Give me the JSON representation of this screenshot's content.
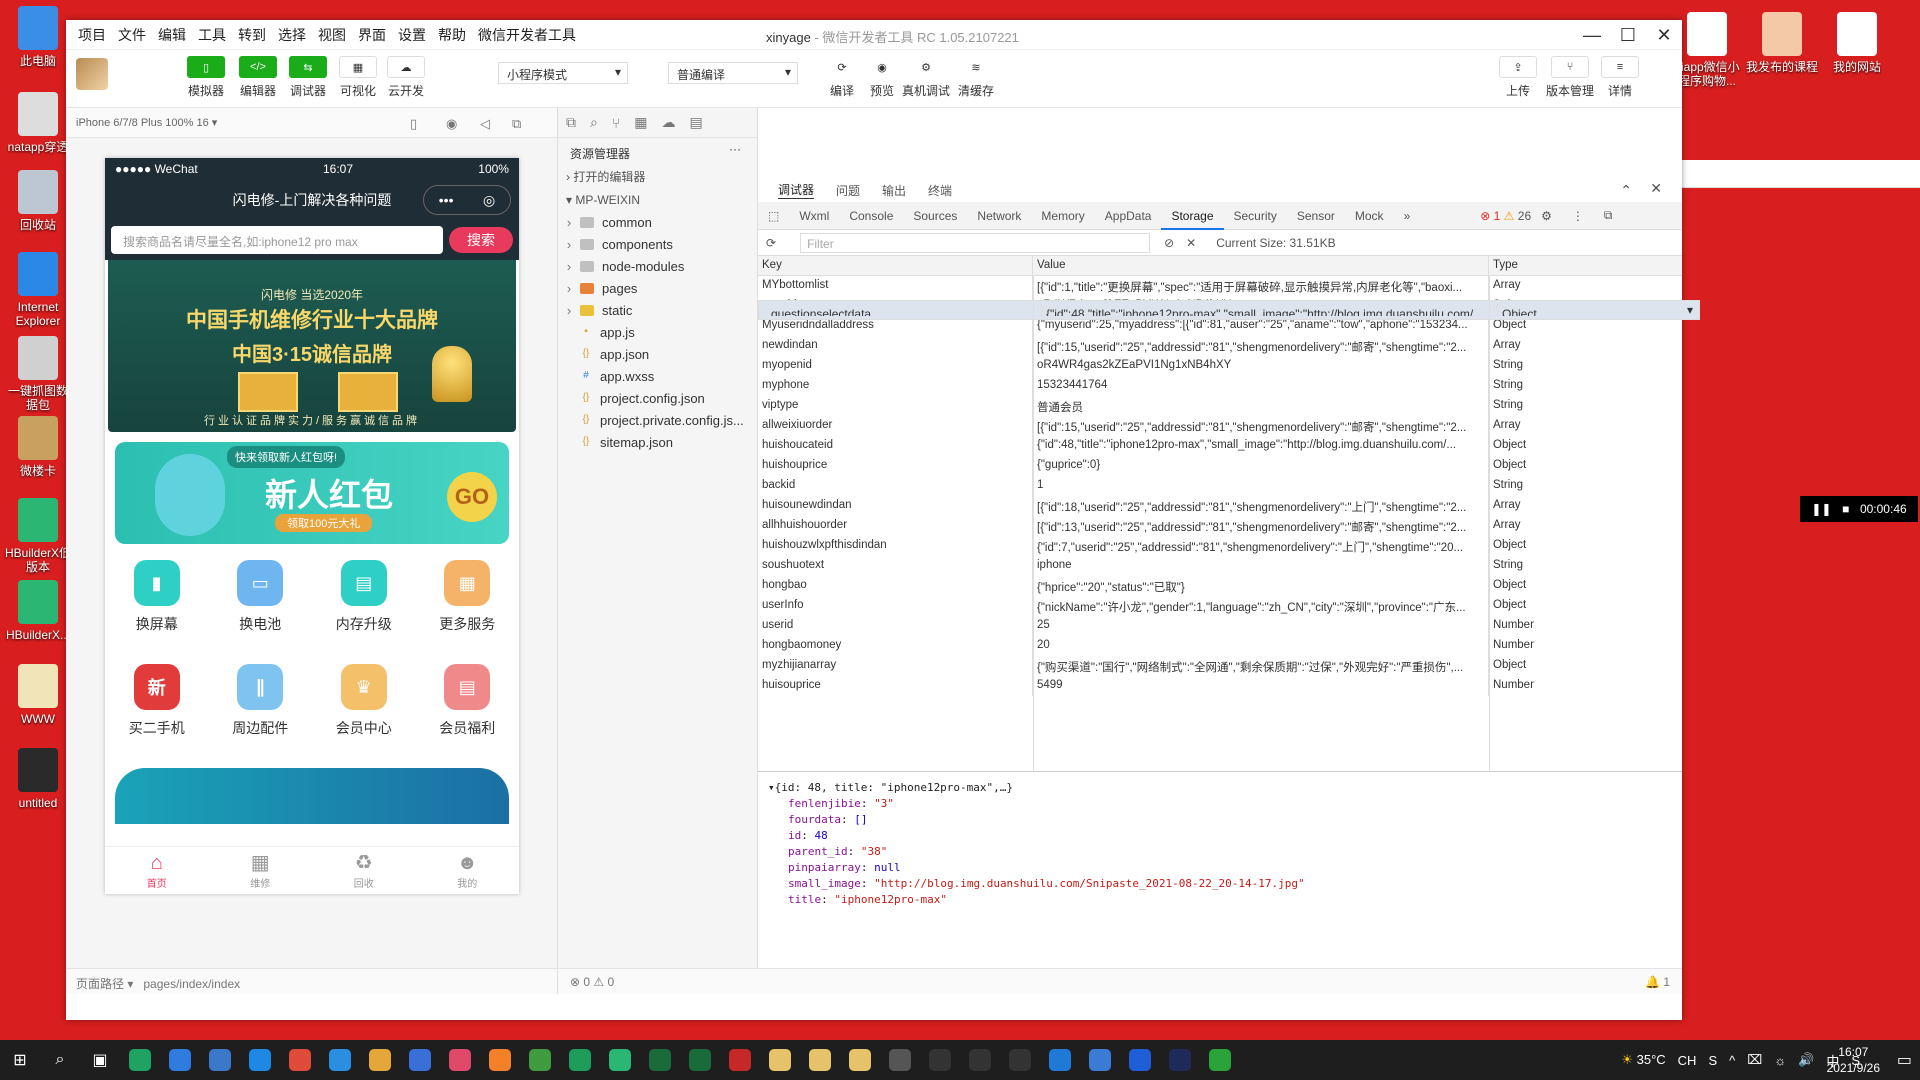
{
  "desktop": {
    "left_icons": [
      {
        "label": "此电脑",
        "color": "#3a8ee6"
      },
      {
        "label": "natapp穿透",
        "color": "#dddddd"
      },
      {
        "label": "回收站",
        "color": "#bcc7d1"
      },
      {
        "label": "Internet Explorer",
        "color": "#2b88e6"
      },
      {
        "label": "一键抓图数据包",
        "color": "#d0d0d0"
      },
      {
        "label": "微楼卡",
        "color": "#c8a060"
      },
      {
        "label": "HBuilderX低版本",
        "color": "#2bb673"
      },
      {
        "label": "HBuilderX...",
        "color": "#2bb673"
      },
      {
        "label": "WWW",
        "color": "#f0e4b8"
      },
      {
        "label": "untitled",
        "color": "#2a2a2a"
      }
    ],
    "right_icons": [
      {
        "label": "niapp微信小程序购物...",
        "color": "#ffffff"
      },
      {
        "label": "我发布的课程",
        "color": "#f3c9a8"
      },
      {
        "label": "我的网站",
        "color": "#ffffff"
      }
    ]
  },
  "window": {
    "menu": [
      "项目",
      "文件",
      "编辑",
      "工具",
      "转到",
      "选择",
      "视图",
      "界面",
      "设置",
      "帮助",
      "微信开发者工具"
    ],
    "title_name": "xinyage",
    "title_app": " - 微信开发者工具 RC 1.05.2107221",
    "controls": [
      "—",
      "☐",
      "✕"
    ]
  },
  "toolbar": {
    "left_buttons": [
      {
        "label": "模拟器",
        "glyph": "▯",
        "style": "g"
      },
      {
        "label": "编辑器",
        "glyph": "</>",
        "style": "g"
      },
      {
        "label": "调试器",
        "glyph": "⇆",
        "style": "g"
      },
      {
        "label": "可视化",
        "glyph": "▦",
        "style": "w"
      },
      {
        "label": "云开发",
        "glyph": "☁",
        "style": "w"
      }
    ],
    "mode_select": "小程序模式",
    "compile_select": "普通编译",
    "mid_buttons": [
      {
        "label": "编译",
        "glyph": "⟳"
      },
      {
        "label": "预览",
        "glyph": "◉"
      },
      {
        "label": "真机调试",
        "glyph": "⚙"
      },
      {
        "label": "清缓存",
        "glyph": "≋"
      }
    ],
    "right_buttons": [
      {
        "label": "上传",
        "glyph": "⇪"
      },
      {
        "label": "版本管理",
        "glyph": "⑂"
      },
      {
        "label": "详情",
        "glyph": "≡"
      }
    ]
  },
  "simulator": {
    "device": "iPhone 6/7/8 Plus 100% 16 ▾",
    "status_left": "●●●●● WeChat",
    "status_time": "16:07",
    "status_right": "100%",
    "nav_title": "闪电修-上门解决各种问题",
    "search_placeholder": "搜索商品名请尽量全名,如:iphone12 pro max",
    "search_button": "搜索",
    "banner": {
      "line1": "闪电修 当选2020年",
      "line2": "中国手机维修行业十大品牌",
      "line3": "中国3·15诚信品牌",
      "line4": "行业认证品牌实力/服务赢诚信品牌"
    },
    "redpack": {
      "tag": "快来领取新人红包呀!",
      "title": "新人红包",
      "sub": "领取100元大礼",
      "go": "GO"
    },
    "grid": [
      {
        "label": "换屏幕",
        "color": "#2ecfc4",
        "glyph": "▮"
      },
      {
        "label": "换电池",
        "color": "#6fb6f0",
        "glyph": "▭"
      },
      {
        "label": "内存升级",
        "color": "#2ecfc4",
        "glyph": "▤"
      },
      {
        "label": "更多服务",
        "color": "#f5b36a",
        "glyph": "▦"
      },
      {
        "label": "买二手机",
        "color": "#e23b3b",
        "glyph": "新"
      },
      {
        "label": "周边配件",
        "color": "#7fc3f0",
        "glyph": "∥"
      },
      {
        "label": "会员中心",
        "color": "#f5c06a",
        "glyph": "♛"
      },
      {
        "label": "会员福利",
        "color": "#f08a8a",
        "glyph": "▤"
      }
    ],
    "tabs": [
      {
        "label": "首页",
        "glyph": "⌂",
        "active": true
      },
      {
        "label": "维修",
        "glyph": "▦",
        "active": false
      },
      {
        "label": "回收",
        "glyph": "♻",
        "active": false
      },
      {
        "label": "我的",
        "glyph": "☻",
        "active": false
      }
    ],
    "footer_path_label": "页面路径 ▾",
    "footer_path": "pages/index/index"
  },
  "explorer": {
    "title": "资源管理器",
    "open_editors": "打开的编辑器",
    "project": "MP-WEIXIN",
    "items": [
      {
        "name": "common",
        "kind": "folder",
        "arrow": "›"
      },
      {
        "name": "components",
        "kind": "folder",
        "arrow": "›"
      },
      {
        "name": "node-modules",
        "kind": "folder",
        "arrow": "›"
      },
      {
        "name": "pages",
        "kind": "folder-o",
        "arrow": "›"
      },
      {
        "name": "static",
        "kind": "folder-y",
        "arrow": "›"
      },
      {
        "name": "app.js",
        "kind": "js",
        "arrow": ""
      },
      {
        "name": "app.json",
        "kind": "json",
        "arrow": ""
      },
      {
        "name": "app.wxss",
        "kind": "wxss",
        "arrow": ""
      },
      {
        "name": "project.config.json",
        "kind": "json",
        "arrow": ""
      },
      {
        "name": "project.private.config.js...",
        "kind": "json",
        "arrow": ""
      },
      {
        "name": "sitemap.json",
        "kind": "json",
        "arrow": ""
      }
    ],
    "footer": "⊗ 0 ⚠ 0"
  },
  "devtools": {
    "head_tabs": [
      "调试器",
      "问题",
      "输出",
      "终端"
    ],
    "panels": [
      "Wxml",
      "Console",
      "Sources",
      "Network",
      "Memory",
      "AppData",
      "Storage",
      "Security",
      "Sensor",
      "Mock",
      "»"
    ],
    "active_panel": "Storage",
    "errors": "1",
    "warnings": "26",
    "filter_placeholder": "Filter",
    "current_size": "Current Size: 31.51KB",
    "columns": [
      "Key",
      "Value",
      "Type"
    ],
    "rows": [
      {
        "key": "questionselectdata",
        "value": "{\"id\":48,\"title\":\"iphone12pro-max\",\"small_image\":\"http://blog.img.duanshuilu.com/...",
        "type": "Object"
      },
      {
        "key": "MYbottomlist",
        "value": "[{\"id\":1,\"title\":\"更换屏幕\",\"spec\":\"适用于屏幕破碎,显示触摸异常,内屏老化等\",\"baoxi...",
        "type": "Array"
      },
      {
        "key": "openid",
        "value": "oR4WR4gas2kZEaPVI1Ng1xNB4hXY",
        "type": "String"
      },
      {
        "key": "Myuseridndalladdress",
        "value": "{\"myuserid\":25,\"myaddress\":[{\"id\":81,\"auser\":\"25\",\"aname\":\"tow\",\"aphone\":\"153234...",
        "type": "Object"
      },
      {
        "key": "newdindan",
        "value": "[{\"id\":15,\"userid\":\"25\",\"addressid\":\"81\",\"shengmenordelivery\":\"邮寄\",\"shengtime\":\"2...",
        "type": "Array"
      },
      {
        "key": "myopenid",
        "value": "oR4WR4gas2kZEaPVI1Ng1xNB4hXY",
        "type": "String"
      },
      {
        "key": "myphone",
        "value": "15323441764",
        "type": "String"
      },
      {
        "key": "viptype",
        "value": "普通会员",
        "type": "String"
      },
      {
        "key": "allweixiuorder",
        "value": "[{\"id\":15,\"userid\":\"25\",\"addressid\":\"81\",\"shengmenordelivery\":\"邮寄\",\"shengtime\":\"2...",
        "type": "Array"
      },
      {
        "key": "huishoucateid",
        "value": "{\"id\":48,\"title\":\"iphone12pro-max\",\"small_image\":\"http://blog.img.duanshuilu.com/...",
        "type": "Object"
      },
      {
        "key": "huishouprice",
        "value": "{\"guprice\":0}",
        "type": "Object"
      },
      {
        "key": "backid",
        "value": "1",
        "type": "String"
      },
      {
        "key": "huisounewdindan",
        "value": "[{\"id\":18,\"userid\":\"25\",\"addressid\":\"81\",\"shengmenordelivery\":\"上门\",\"shengtime\":\"2...",
        "type": "Array"
      },
      {
        "key": "allhhuishouorder",
        "value": "[{\"id\":13,\"userid\":\"25\",\"addressid\":\"81\",\"shengmenordelivery\":\"邮寄\",\"shengtime\":\"2...",
        "type": "Array"
      },
      {
        "key": "huishouzwlxpfthisdindan",
        "value": "{\"id\":7,\"userid\":\"25\",\"addressid\":\"81\",\"shengmenordelivery\":\"上门\",\"shengtime\":\"20...",
        "type": "Object"
      },
      {
        "key": "soushuotext",
        "value": "iphone",
        "type": "String"
      },
      {
        "key": "hongbao",
        "value": "{\"hprice\":\"20\",\"status\":\"已取\"}",
        "type": "Object"
      },
      {
        "key": "userInfo",
        "value": "{\"nickName\":\"许小龙\",\"gender\":1,\"language\":\"zh_CN\",\"city\":\"深圳\",\"province\":\"广东...",
        "type": "Object"
      },
      {
        "key": "userid",
        "value": "25",
        "type": "Number"
      },
      {
        "key": "hongbaomoney",
        "value": "20",
        "type": "Number"
      },
      {
        "key": "myzhijianarray",
        "value": "{\"购买渠道\":\"国行\",\"网络制式\":\"全网通\",\"剩余保质期\":\"过保\",\"外观完好\":\"严重损伤\",...",
        "type": "Object"
      },
      {
        "key": "huisouprice",
        "value": "5499",
        "type": "Number"
      }
    ],
    "preview": {
      "head": "▾{id: 48, title: \"iphone12pro-max\",…}",
      "lines": [
        {
          "k": "fenlenjibie",
          "v": "\"3\"",
          "t": "s"
        },
        {
          "k": "fourdata",
          "v": "[]",
          "t": "n"
        },
        {
          "k": "id",
          "v": "48",
          "t": "n"
        },
        {
          "k": "parent_id",
          "v": "\"38\"",
          "t": "s"
        },
        {
          "k": "pinpaiarray",
          "v": "null",
          "t": "n"
        },
        {
          "k": "small_image",
          "v": "\"http://blog.img.duanshuilu.com/Snipaste_2021-08-22_20-14-17.jpg\"",
          "t": "s"
        },
        {
          "k": "title",
          "v": "\"iphone12pro-max\"",
          "t": "s"
        }
      ]
    },
    "footer_right": "🔔 1"
  },
  "recorder": {
    "time": "00:00:46"
  },
  "taskbar": {
    "apps": [
      "#1ea362",
      "#2f7be0",
      "#3b78c8",
      "#1e88e5",
      "#e04a3a",
      "#2a8fe0",
      "#e5a63a",
      "#3a6fd8",
      "#e04a6a",
      "#f5802a",
      "#3e9c3e",
      "#1e9c5a",
      "#2bb673",
      "#1a6b3a",
      "#1a6b3a",
      "#c62828",
      "#e6c36a",
      "#e6c36a",
      "#e6c36a",
      "#555555",
      "#333333",
      "#333333",
      "#333333",
      "#1e7ad6",
      "#3a7bd6",
      "#1e5ed6",
      "#1e2a5a",
      "#2aa33a"
    ],
    "weather": "35°C",
    "tray": [
      "CH",
      "S",
      "^",
      "⌧",
      "☼",
      "🔊",
      "中",
      "S"
    ],
    "time": "16:07",
    "date": "2021/9/26"
  }
}
